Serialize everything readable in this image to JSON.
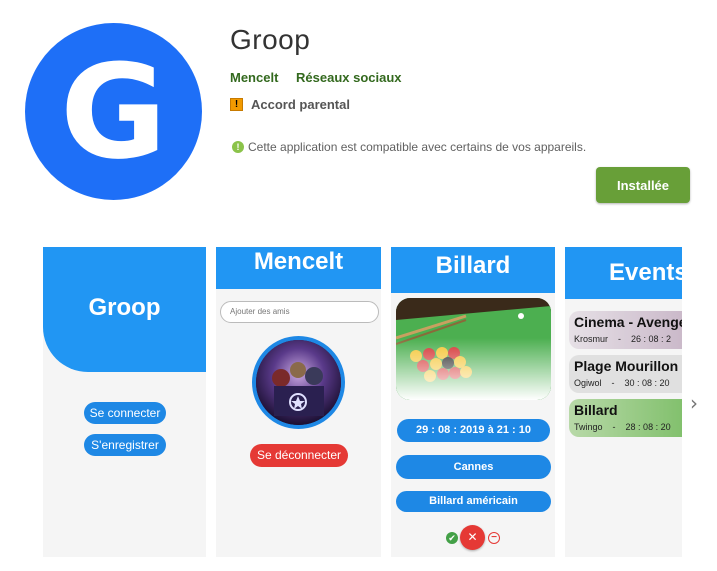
{
  "app": {
    "icon_letter": "G",
    "title": "Groop",
    "developer": "Mencelt",
    "category": "Réseaux sociaux",
    "rating_label": "Accord parental",
    "rating_badge_symbol": "!",
    "compatibility_text": "Cette application est compatible avec certains de vos appareils.",
    "info_icon_symbol": "!",
    "install_button_label": "Installée"
  },
  "colors": {
    "brand_blue": "#1e6ff7",
    "screen_blue": "#2196f3",
    "install_green": "#689f38",
    "developer_green": "#33691e",
    "danger_red": "#e53935"
  },
  "screenshots": {
    "s1": {
      "title": "Groop",
      "login_button": "Se connecter",
      "register_button": "S'enregistrer"
    },
    "s2": {
      "title": "Mencelt",
      "search_placeholder": "Ajouter des amis",
      "logout_button": "Se déconnecter"
    },
    "s3": {
      "title": "Billard",
      "datetime": "29 : 08 : 2019 à 21 : 10",
      "location": "Cannes",
      "game": "Billard américain",
      "confirm_symbol": "✔",
      "close_symbol": "✕",
      "decline_symbol": "−"
    },
    "s4": {
      "title": "Events",
      "events": [
        {
          "name": "Cinema - Avengers",
          "organizer": "Krosmur",
          "date": "26 : 08 : 2"
        },
        {
          "name": "Plage Mourillon",
          "organizer": "Ogiwol",
          "date": "30 : 08 : 20"
        },
        {
          "name": "Billard",
          "organizer": "Twingo",
          "date": "28 : 08 : 20"
        }
      ]
    }
  },
  "nav": {
    "next_symbol": "›"
  }
}
